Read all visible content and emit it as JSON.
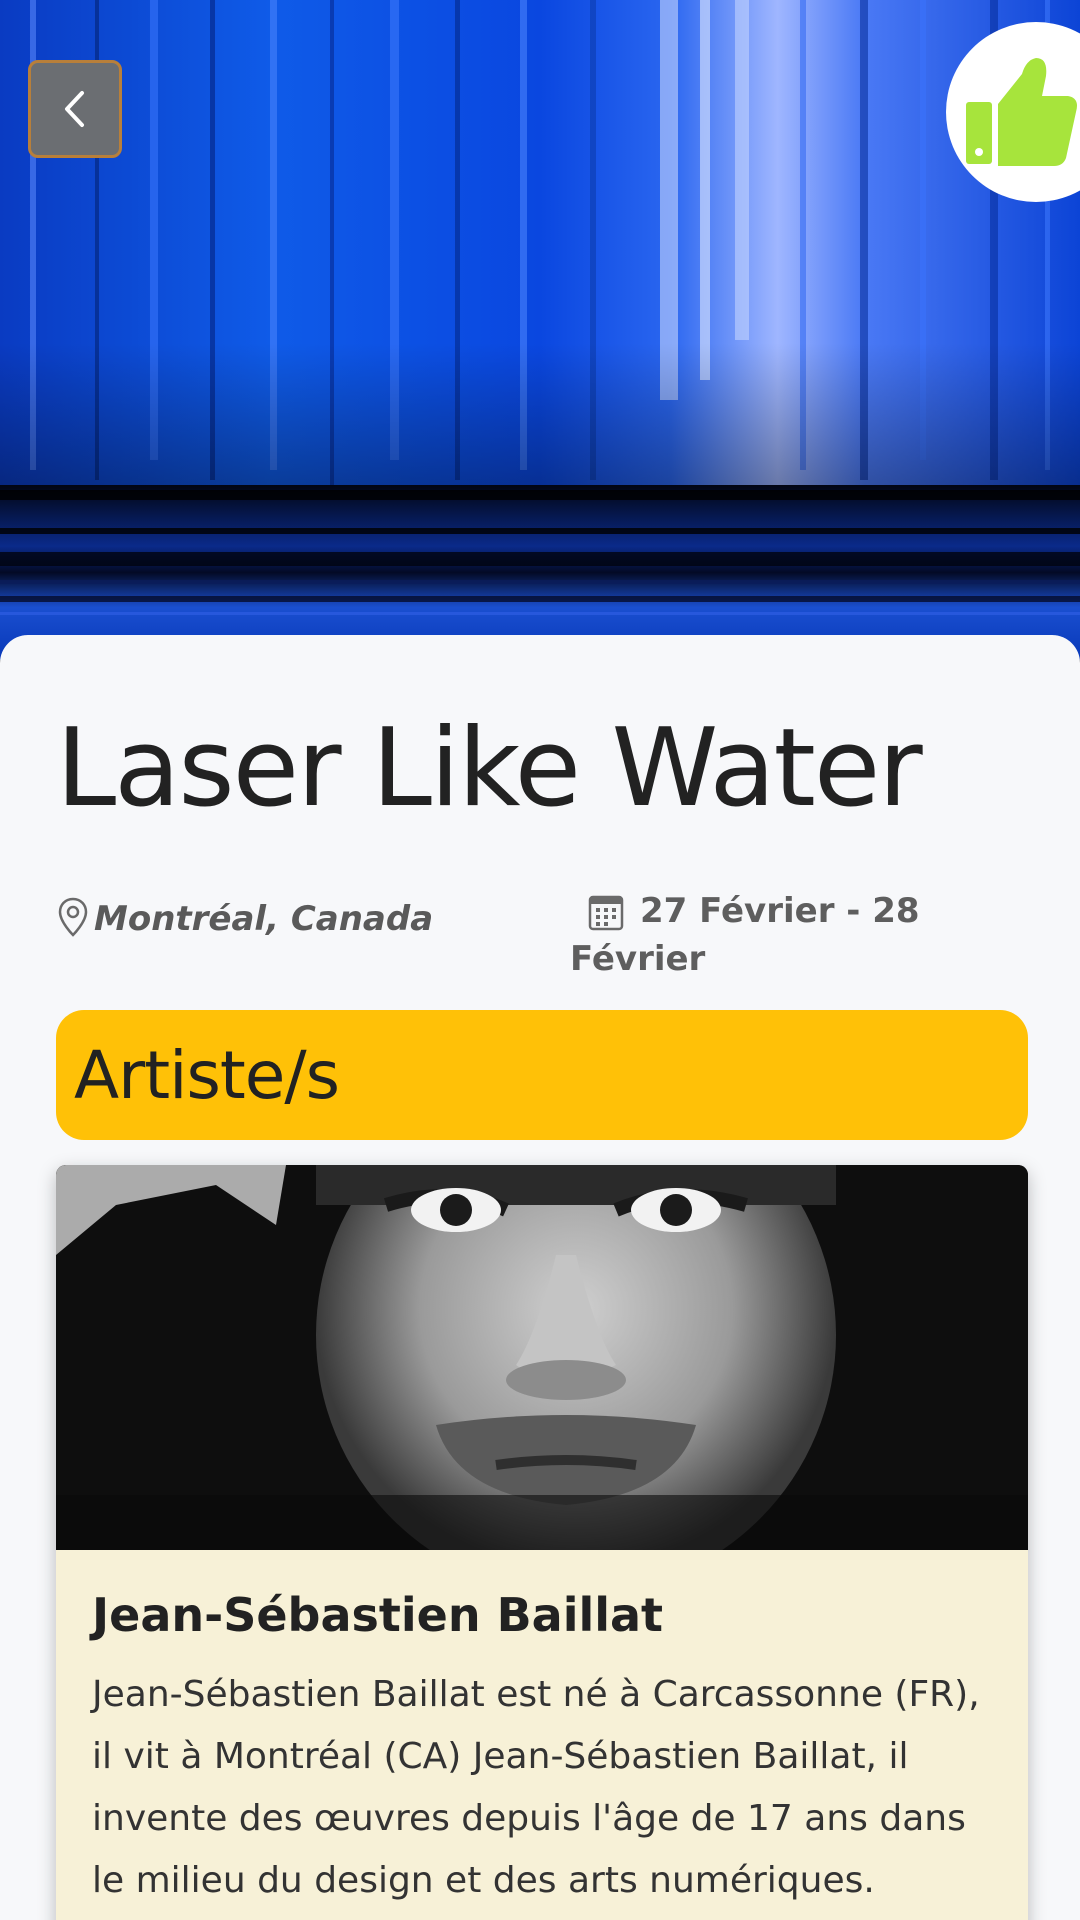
{
  "event": {
    "title": "Laser Like Water",
    "location": "Montréal, Canada",
    "date": "27 Février - 28 Février"
  },
  "sections": {
    "artists_heading": "Artiste/s"
  },
  "artist": {
    "name": "Jean-Sébastien Baillat",
    "bio": "Jean-Sébastien Baillat est né à Carcassonne (FR), il vit à Montréal (CA) Jean-Sébastien Baillat, il invente des œuvres depuis l'âge de 17 ans dans le milieu du design et des arts numériques."
  },
  "icons": {
    "back": "chevron-left-icon",
    "like": "thumbs-up-icon",
    "location": "map-pin-icon",
    "date": "calendar-icon"
  },
  "colors": {
    "accent": "#ffc107",
    "like": "#a7e43c",
    "card": "#f7f1d7",
    "panel": "#f7f8fa"
  }
}
